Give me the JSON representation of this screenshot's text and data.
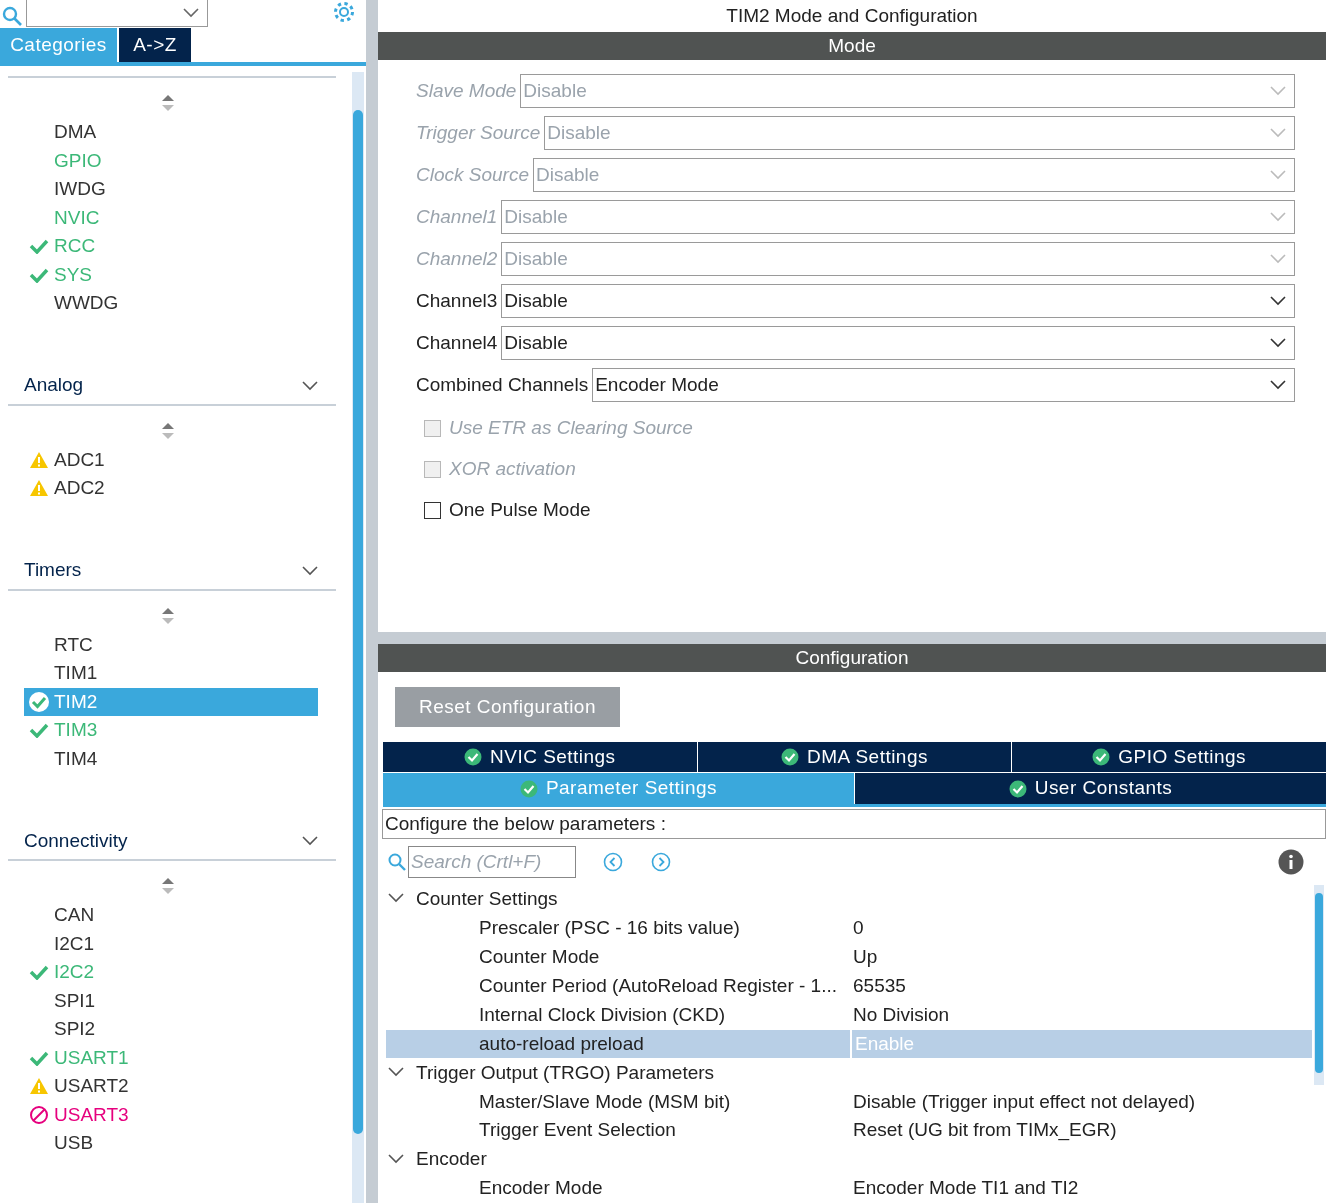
{
  "sidebar": {
    "tabs": [
      {
        "label": "Categories",
        "selected": true
      },
      {
        "label": "A->Z",
        "selected": false
      }
    ],
    "sections": [
      {
        "items": [
          {
            "label": "DMA",
            "kind": "plain",
            "color": "#333333",
            "selected": false
          },
          {
            "label": "GPIO",
            "kind": "plain",
            "color": "#3cb878",
            "selected": false
          },
          {
            "label": "IWDG",
            "kind": "plain",
            "color": "#333333",
            "selected": false
          },
          {
            "label": "NVIC",
            "kind": "plain",
            "color": "#3cb878",
            "selected": false
          },
          {
            "label": "RCC",
            "kind": "check",
            "color": "#3cb878",
            "selected": false
          },
          {
            "label": "SYS",
            "kind": "check",
            "color": "#3cb878",
            "selected": false
          },
          {
            "label": "WWDG",
            "kind": "plain",
            "color": "#333333",
            "selected": false
          }
        ]
      },
      {
        "title": "Analog",
        "items": [
          {
            "label": "ADC1",
            "kind": "warning",
            "color": "#333333",
            "selected": false
          },
          {
            "label": "ADC2",
            "kind": "warning",
            "color": "#333333",
            "selected": false
          }
        ]
      },
      {
        "title": "Timers",
        "items": [
          {
            "label": "RTC",
            "kind": "plain",
            "color": "#333333",
            "selected": false
          },
          {
            "label": "TIM1",
            "kind": "plain",
            "color": "#333333",
            "selected": false
          },
          {
            "label": "TIM2",
            "kind": "check",
            "selected": true
          },
          {
            "label": "TIM3",
            "kind": "check",
            "color": "#3cb878",
            "selected": false
          },
          {
            "label": "TIM4",
            "kind": "plain",
            "color": "#333333",
            "selected": false
          }
        ]
      },
      {
        "title": "Connectivity",
        "items": [
          {
            "label": "CAN",
            "kind": "plain",
            "color": "#333333",
            "selected": false
          },
          {
            "label": "I2C1",
            "kind": "plain",
            "color": "#333333",
            "selected": false
          },
          {
            "label": "I2C2",
            "kind": "check",
            "color": "#3cb878",
            "selected": false
          },
          {
            "label": "SPI1",
            "kind": "plain",
            "color": "#333333",
            "selected": false
          },
          {
            "label": "SPI2",
            "kind": "plain",
            "color": "#333333",
            "selected": false
          },
          {
            "label": "USART1",
            "kind": "check",
            "color": "#3cb878",
            "selected": false
          },
          {
            "label": "USART2",
            "kind": "warning",
            "color": "#333333",
            "selected": false
          },
          {
            "label": "USART3",
            "kind": "blocked",
            "color": "#e6007e",
            "selected": false
          },
          {
            "label": "USB",
            "kind": "plain",
            "color": "#333333",
            "selected": false
          }
        ]
      }
    ]
  },
  "panel": {
    "title": "TIM2 Mode and Configuration",
    "mode": {
      "header": "Mode",
      "fields": [
        {
          "label": "Slave Mode",
          "value": "Disable",
          "disabled": true
        },
        {
          "label": "Trigger Source",
          "value": "Disable",
          "disabled": true
        },
        {
          "label": "Clock Source",
          "value": "Disable",
          "disabled": true
        },
        {
          "label": "Channel1",
          "value": "Disable",
          "disabled": true
        },
        {
          "label": "Channel2",
          "value": "Disable",
          "disabled": true
        },
        {
          "label": "Channel3",
          "value": "Disable",
          "disabled": false
        },
        {
          "label": "Channel4",
          "value": "Disable",
          "disabled": false
        },
        {
          "label": "Combined Channels",
          "value": "Encoder Mode",
          "disabled": false
        }
      ],
      "checkboxes": [
        {
          "label": "Use ETR as Clearing Source",
          "disabled": true,
          "checked": false
        },
        {
          "label": "XOR activation",
          "disabled": true,
          "checked": false
        },
        {
          "label": "One Pulse Mode",
          "disabled": false,
          "checked": false
        }
      ]
    },
    "configuration": {
      "header": "Configuration",
      "reset_button": "Reset Configuration",
      "tab_rows": [
        [
          {
            "label": "NVIC Settings",
            "selected": false
          },
          {
            "label": "DMA Settings",
            "selected": false
          },
          {
            "label": "GPIO Settings",
            "selected": false
          }
        ],
        [
          {
            "label": "Parameter Settings",
            "selected": true
          },
          {
            "label": "User Constants",
            "selected": false
          }
        ]
      ],
      "hint": "Configure the below parameters :",
      "search": {
        "placeholder": "Search (Crtl+F)"
      },
      "groups": [
        {
          "name": "Counter Settings",
          "expanded": true,
          "children": [
            {
              "name": "Prescaler (PSC - 16 bits value)",
              "value": "0",
              "selected": false
            },
            {
              "name": "Counter Mode",
              "value": "Up",
              "selected": false
            },
            {
              "name": "Counter Period (AutoReload Register - 1...",
              "value": "65535",
              "selected": false
            },
            {
              "name": "Internal Clock Division (CKD)",
              "value": "No Division",
              "selected": false
            },
            {
              "name": "auto-reload preload",
              "value": "Enable",
              "selected": true
            }
          ]
        },
        {
          "name": "Trigger Output (TRGO) Parameters",
          "expanded": true,
          "children": [
            {
              "name": "Master/Slave Mode (MSM bit)",
              "value": "Disable (Trigger input effect not delayed)",
              "selected": false
            },
            {
              "name": "Trigger Event Selection",
              "value": "Reset (UG bit from TIMx_EGR)",
              "selected": false
            }
          ]
        },
        {
          "name": "Encoder",
          "expanded": true,
          "children": [
            {
              "name": "Encoder Mode",
              "value": "Encoder Mode TI1 and TI2",
              "selected": false
            }
          ]
        }
      ]
    }
  }
}
